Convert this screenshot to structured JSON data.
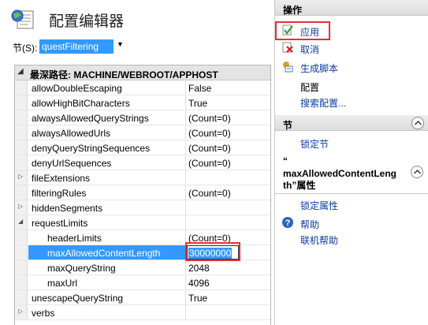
{
  "header": {
    "title": "配置编辑器"
  },
  "section": {
    "label": "节(S):",
    "value": "questFiltering"
  },
  "grid": {
    "path_label": "最深路径: MACHINE/WEBROOT/APPHOST",
    "rows": [
      {
        "name": "allowDoubleEscaping",
        "value": "False"
      },
      {
        "name": "allowHighBitCharacters",
        "value": "True"
      },
      {
        "name": "alwaysAllowedQueryStrings",
        "value": "(Count=0)"
      },
      {
        "name": "alwaysAllowedUrls",
        "value": "(Count=0)"
      },
      {
        "name": "denyQueryStringSequences",
        "value": "(Count=0)"
      },
      {
        "name": "denyUrlSequences",
        "value": "(Count=0)"
      },
      {
        "name": "fileExtensions",
        "value": ""
      },
      {
        "name": "filteringRules",
        "value": "(Count=0)"
      },
      {
        "name": "hiddenSegments",
        "value": ""
      },
      {
        "name": "requestLimits",
        "value": ""
      },
      {
        "name": "headerLimits",
        "value": "(Count=0)"
      },
      {
        "name": "maxAllowedContentLength",
        "value": "30000000"
      },
      {
        "name": "maxQueryString",
        "value": "2048"
      },
      {
        "name": "maxUrl",
        "value": "4096"
      },
      {
        "name": "unescapeQueryString",
        "value": "True"
      },
      {
        "name": "verbs",
        "value": ""
      }
    ]
  },
  "actions_pane": {
    "title": "操作",
    "apply": "应用",
    "cancel": "取消",
    "generate_script": "生成脚本",
    "config_heading": "配置",
    "search_config": "搜索配置...",
    "section_title": "节",
    "lock_section": "锁定节",
    "attr_quote": "“",
    "attr_title_line1": "maxAllowedContentLeng",
    "attr_title_line2": "th”属性",
    "lock_attribute": "锁定属性",
    "help": "帮助",
    "online_help": "联机帮助"
  },
  "colors": {
    "selection": "#3399ff",
    "highlight_box": "#e53030",
    "link": "#0a3c9e"
  }
}
